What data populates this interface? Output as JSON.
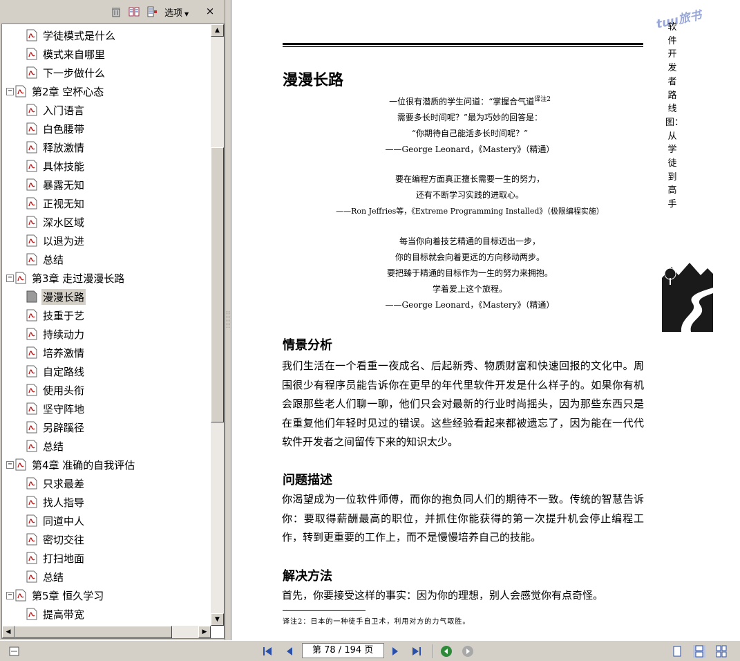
{
  "bookmarks_toolbar": {
    "options_label": "选项",
    "close_label": "×"
  },
  "bookmarks": {
    "rows": [
      {
        "label": "学徒模式是什么"
      },
      {
        "label": "模式来自哪里"
      },
      {
        "label": "下一步做什么"
      },
      {
        "label": "第2章 空杯心态"
      },
      {
        "label": "入门语言"
      },
      {
        "label": "白色腰带"
      },
      {
        "label": "释放激情"
      },
      {
        "label": "具体技能"
      },
      {
        "label": "暴露无知"
      },
      {
        "label": "正视无知"
      },
      {
        "label": "深水区域"
      },
      {
        "label": "以退为进"
      },
      {
        "label": "总结"
      },
      {
        "label": "第3章 走过漫漫长路"
      },
      {
        "label": "漫漫长路"
      },
      {
        "label": "技重于艺"
      },
      {
        "label": "持续动力"
      },
      {
        "label": "培养激情"
      },
      {
        "label": "自定路线"
      },
      {
        "label": "使用头衔"
      },
      {
        "label": "坚守阵地"
      },
      {
        "label": "另辟蹊径"
      },
      {
        "label": "总结"
      },
      {
        "label": "第4章 准确的自我评估"
      },
      {
        "label": "只求最差"
      },
      {
        "label": "找人指导"
      },
      {
        "label": "同道中人"
      },
      {
        "label": "密切交往"
      },
      {
        "label": "打扫地面"
      },
      {
        "label": "总结"
      },
      {
        "label": "第5章 恒久学习"
      },
      {
        "label": "提高带宽"
      }
    ]
  },
  "document": {
    "watermark": "tuu旅书",
    "side_title": "软件开发者路线图：从学徒到高手",
    "page_title": "漫漫长路",
    "quote1": {
      "l1_pre": "一位很有潜质的学生问道：“掌握合气道",
      "l1_sup": "译注2",
      "l2": "需要多长时间呢？”最为巧妙的回答是：",
      "l3": "“你期待自己能活多长时间呢？”",
      "attr": "——George Leonard，《Mastery》（精通）"
    },
    "quote2": {
      "l1": "要在编程方面真正擅长需要一生的努力，",
      "l2": "还有不断学习实践的进取心。",
      "attr": "——Ron Jeffries等，《Extreme Programming Installed》（极限编程实施）"
    },
    "quote3": {
      "l1": "每当你向着技艺精通的目标迈出一步，",
      "l2": "你的目标就会向着更远的方向移动两步。",
      "l3": "要把臻于精通的目标作为一生的努力来拥抱。",
      "l4": "学着爱上这个旅程。",
      "attr": "——George Leonard，《Mastery》（精通）"
    },
    "section1": {
      "heading": "情景分析",
      "body": "我们生活在一个看重一夜成名、后起新秀、物质财富和快速回报的文化中。周围很少有程序员能告诉你在更早的年代里软件开发是什么样子的。如果你有机会跟那些老人们聊一聊，他们只会对最新的行业时尚摇头，因为那些东西只是在重复他们年轻时见过的错误。这些经验看起来都被遗忘了，因为能在一代代软件开发者之间留传下来的知识太少。"
    },
    "section2": {
      "heading": "问题描述",
      "body": "你渴望成为一位软件师傅，而你的抱负同人们的期待不一致。传统的智慧告诉你：要取得薪酬最高的职位，并抓住你能获得的第一次提升机会停止编程工作，转到更重要的工作上，而不是慢慢培养自己的技能。"
    },
    "section3": {
      "heading": "解决方法",
      "body": "首先，你要接受这样的事实：因为你的理想，别人会感觉你有点奇怪。"
    },
    "footnote": "译注2：日本的一种徒手自卫术，利用对方的力气取胜。"
  },
  "status": {
    "page_indicator": "第 78 / 194 页"
  },
  "colors": {
    "chrome": "#d4d0c8",
    "nav_green": "#2f8a3a",
    "nav_blue": "#2a4fa8"
  }
}
